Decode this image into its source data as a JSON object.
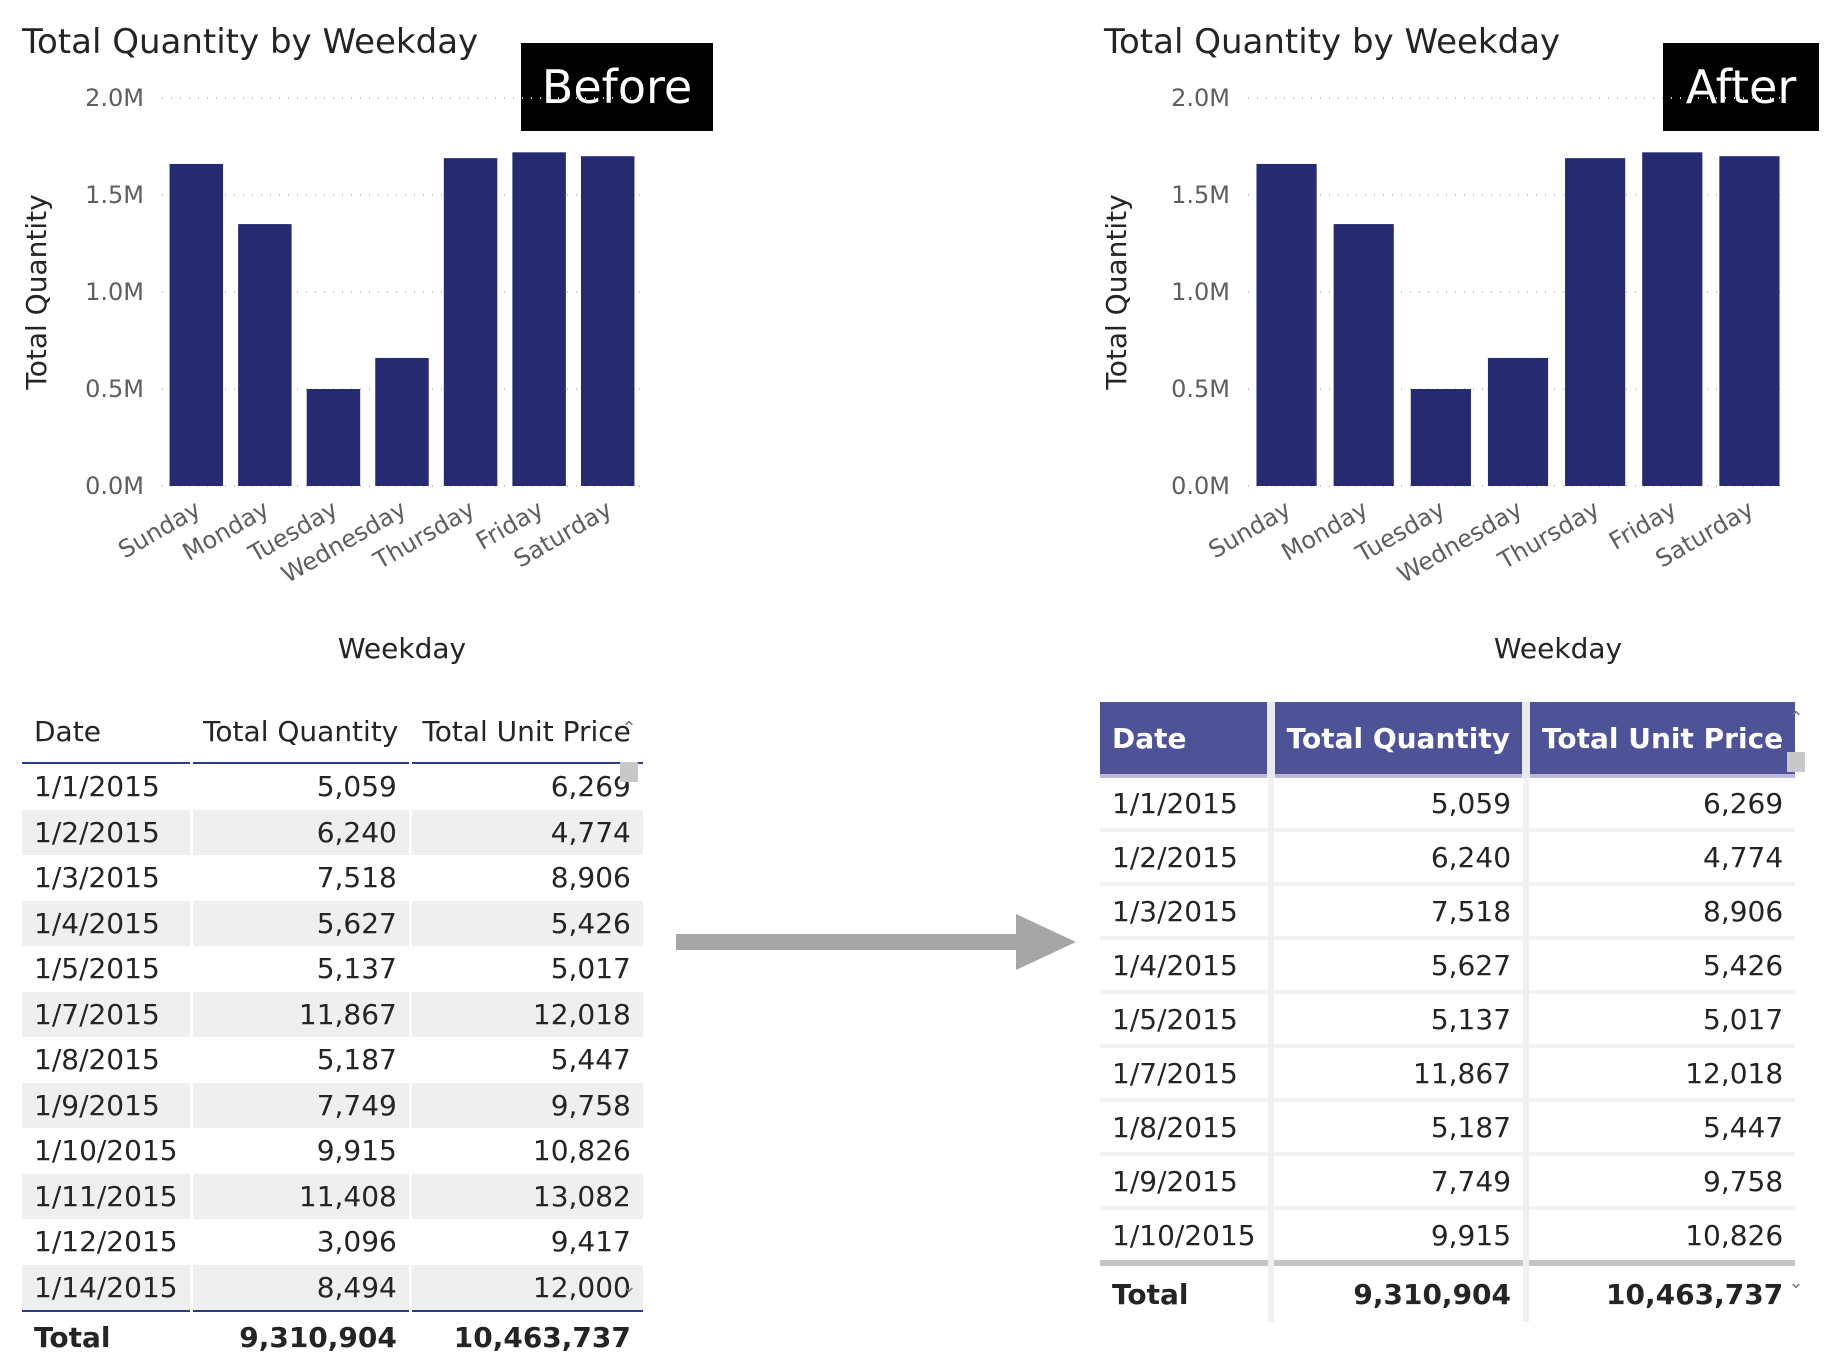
{
  "before": {
    "label": "Before",
    "chart_data": {
      "type": "bar",
      "title": "Total Quantity by Weekday",
      "xlabel": "Weekday",
      "ylabel": "Total Quantity",
      "categories": [
        "Sunday",
        "Monday",
        "Tuesday",
        "Wednesday",
        "Thursday",
        "Friday",
        "Saturday"
      ],
      "values": [
        1.66,
        1.35,
        0.5,
        0.66,
        1.69,
        1.72,
        1.7
      ],
      "ylim": [
        0,
        2.0
      ],
      "yticks": [
        "0.0M",
        "0.5M",
        "1.0M",
        "1.5M",
        "2.0M"
      ],
      "grid": true,
      "color": "#252a71"
    },
    "table": {
      "headers": [
        "Date",
        "Total Quantity",
        "Total Unit Price"
      ],
      "rows": [
        [
          "1/1/2015",
          "5,059",
          "6,269"
        ],
        [
          "1/2/2015",
          "6,240",
          "4,774"
        ],
        [
          "1/3/2015",
          "7,518",
          "8,906"
        ],
        [
          "1/4/2015",
          "5,627",
          "5,426"
        ],
        [
          "1/5/2015",
          "5,137",
          "5,017"
        ],
        [
          "1/7/2015",
          "11,867",
          "12,018"
        ],
        [
          "1/8/2015",
          "5,187",
          "5,447"
        ],
        [
          "1/9/2015",
          "7,749",
          "9,758"
        ],
        [
          "1/10/2015",
          "9,915",
          "10,826"
        ],
        [
          "1/11/2015",
          "11,408",
          "13,082"
        ],
        [
          "1/12/2015",
          "3,096",
          "9,417"
        ],
        [
          "1/14/2015",
          "8,494",
          "12,000"
        ]
      ],
      "total": [
        "Total",
        "9,310,904",
        "10,463,737"
      ]
    }
  },
  "after": {
    "label": "After",
    "chart_data": {
      "type": "bar",
      "title": "Total Quantity by Weekday",
      "xlabel": "Weekday",
      "ylabel": "Total Quantity",
      "categories": [
        "Sunday",
        "Monday",
        "Tuesday",
        "Wednesday",
        "Thursday",
        "Friday",
        "Saturday"
      ],
      "values": [
        1.66,
        1.35,
        0.5,
        0.66,
        1.69,
        1.72,
        1.7
      ],
      "ylim": [
        0,
        2.0
      ],
      "yticks": [
        "0.0M",
        "0.5M",
        "1.0M",
        "1.5M",
        "2.0M"
      ],
      "grid": true,
      "color": "#252a71"
    },
    "table": {
      "headers": [
        "Date",
        "Total Quantity",
        "Total Unit Price"
      ],
      "header_color": "#4e5296",
      "rows": [
        [
          "1/1/2015",
          "5,059",
          "6,269"
        ],
        [
          "1/2/2015",
          "6,240",
          "4,774"
        ],
        [
          "1/3/2015",
          "7,518",
          "8,906"
        ],
        [
          "1/4/2015",
          "5,627",
          "5,426"
        ],
        [
          "1/5/2015",
          "5,137",
          "5,017"
        ],
        [
          "1/7/2015",
          "11,867",
          "12,018"
        ],
        [
          "1/8/2015",
          "5,187",
          "5,447"
        ],
        [
          "1/9/2015",
          "7,749",
          "9,758"
        ],
        [
          "1/10/2015",
          "9,915",
          "10,826"
        ]
      ],
      "total": [
        "Total",
        "9,310,904",
        "10,463,737"
      ]
    }
  },
  "icons": {
    "arrow": "right-arrow-icon",
    "scroll_up": "chevron-up-icon",
    "scroll_down": "chevron-down-icon"
  }
}
